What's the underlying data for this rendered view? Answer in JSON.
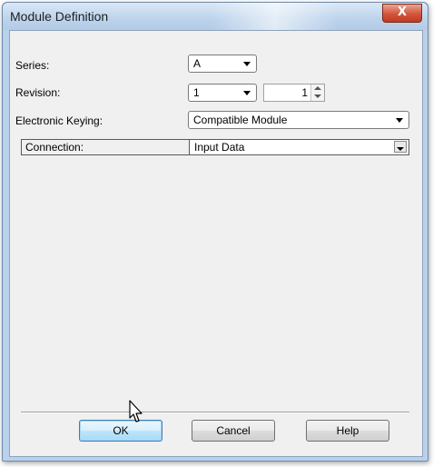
{
  "window": {
    "title": "Module Definition",
    "close_glyph": "X"
  },
  "fields": {
    "series": {
      "label": "Series:",
      "value": "A"
    },
    "revision": {
      "label": "Revision:",
      "major": "1",
      "minor": "1"
    },
    "keying": {
      "label": "Electronic Keying:",
      "value": "Compatible Module"
    },
    "connection": {
      "label": "Connection:",
      "value": "Input Data"
    }
  },
  "buttons": {
    "ok": "OK",
    "cancel": "Cancel",
    "help": "Help"
  }
}
